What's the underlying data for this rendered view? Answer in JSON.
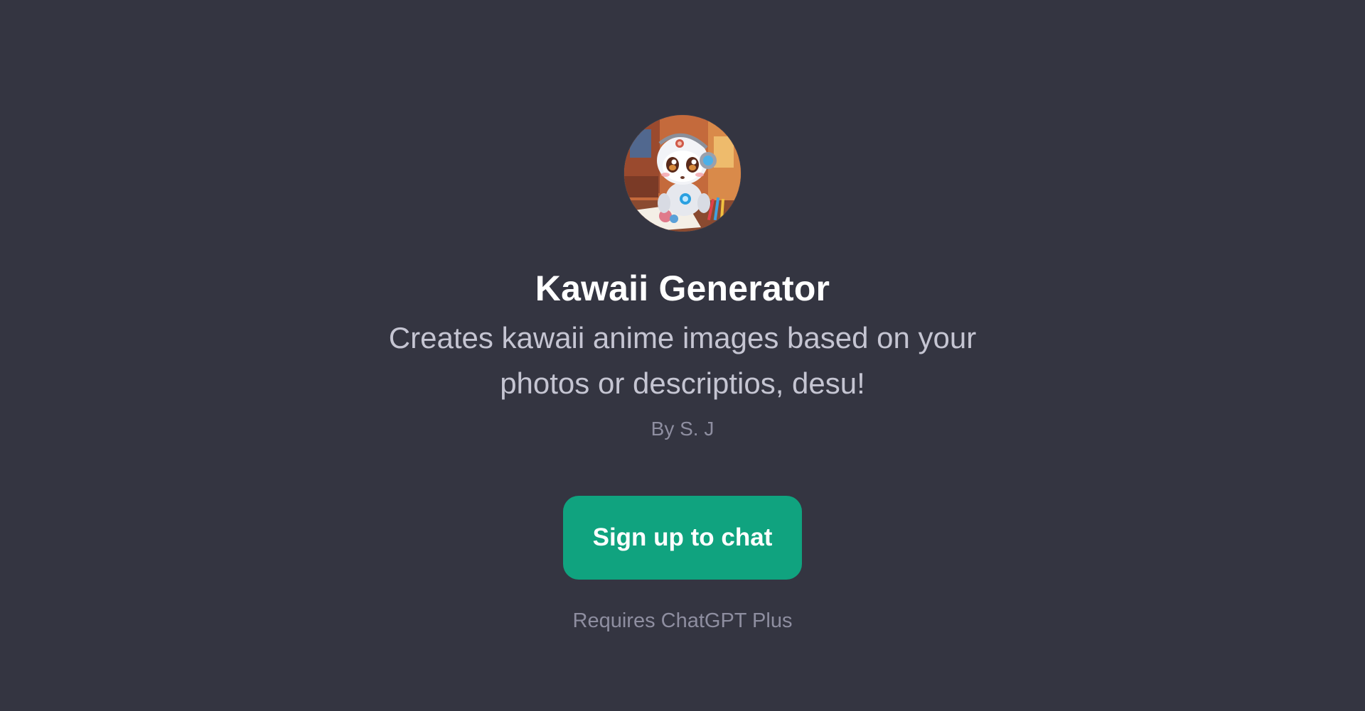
{
  "gpt": {
    "name": "Kawaii Generator",
    "description": "Creates kawaii anime images based on your photos or descriptios, desu!",
    "author": "By S. J",
    "avatar_icon": "robot-artist-avatar"
  },
  "actions": {
    "signup_label": "Sign up to chat",
    "requirement_note": "Requires ChatGPT Plus"
  },
  "colors": {
    "background": "#343541",
    "accent": "#10a37f",
    "title": "#ffffff",
    "description": "#c5c5d2",
    "muted": "#8e8ea0"
  }
}
